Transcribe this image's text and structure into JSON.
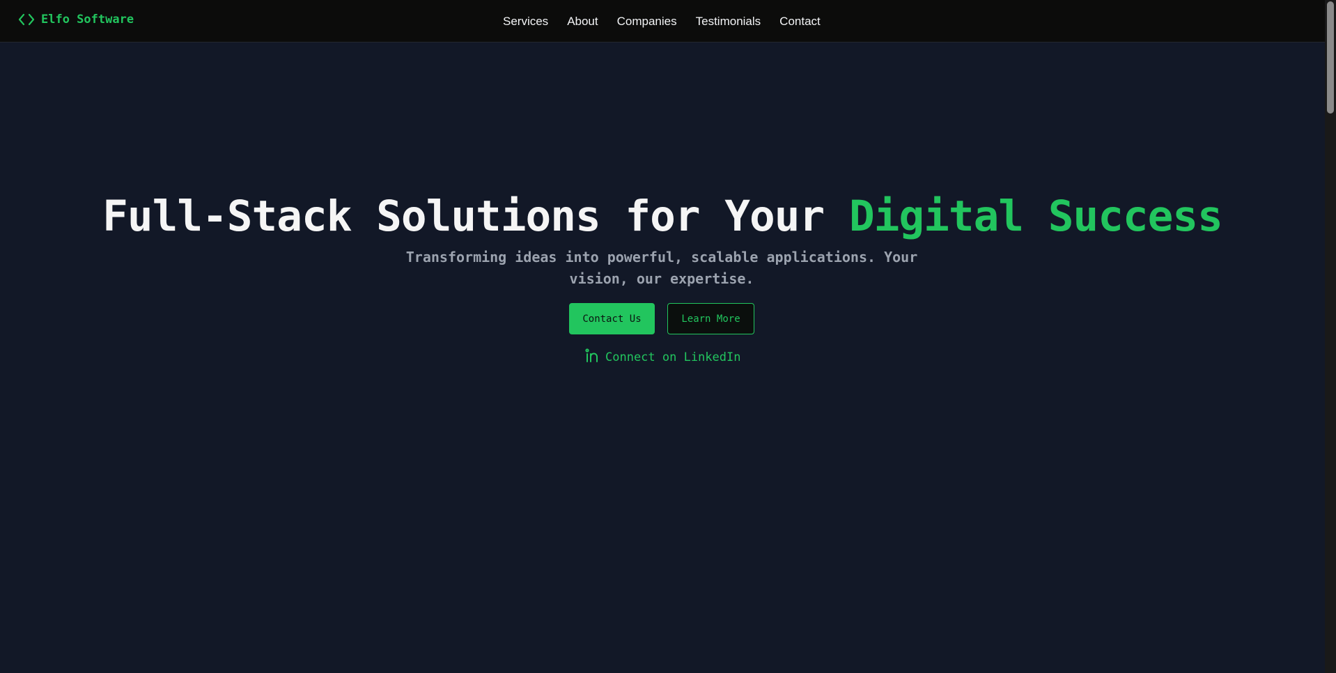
{
  "brand": {
    "name": "Elfo Software",
    "icon": "code-brackets-icon",
    "color": "#22c55e"
  },
  "nav": {
    "links": [
      "Services",
      "About",
      "Companies",
      "Testimonials",
      "Contact"
    ]
  },
  "hero": {
    "title_main": "Full-Stack Solutions for Your ",
    "title_accent": "Digital Success",
    "subtitle": "Transforming ideas into powerful, scalable applications. Your vision, our expertise.",
    "primary_button": "Contact Us",
    "secondary_button": "Learn More",
    "linkedin_label": "Connect on LinkedIn",
    "linkedin_icon": "linkedin-icon"
  },
  "colors": {
    "background": "#121827",
    "navbar": "#0c0c0b",
    "accent": "#22c55e",
    "text": "#f5f5f5",
    "muted": "#9ca3af"
  }
}
